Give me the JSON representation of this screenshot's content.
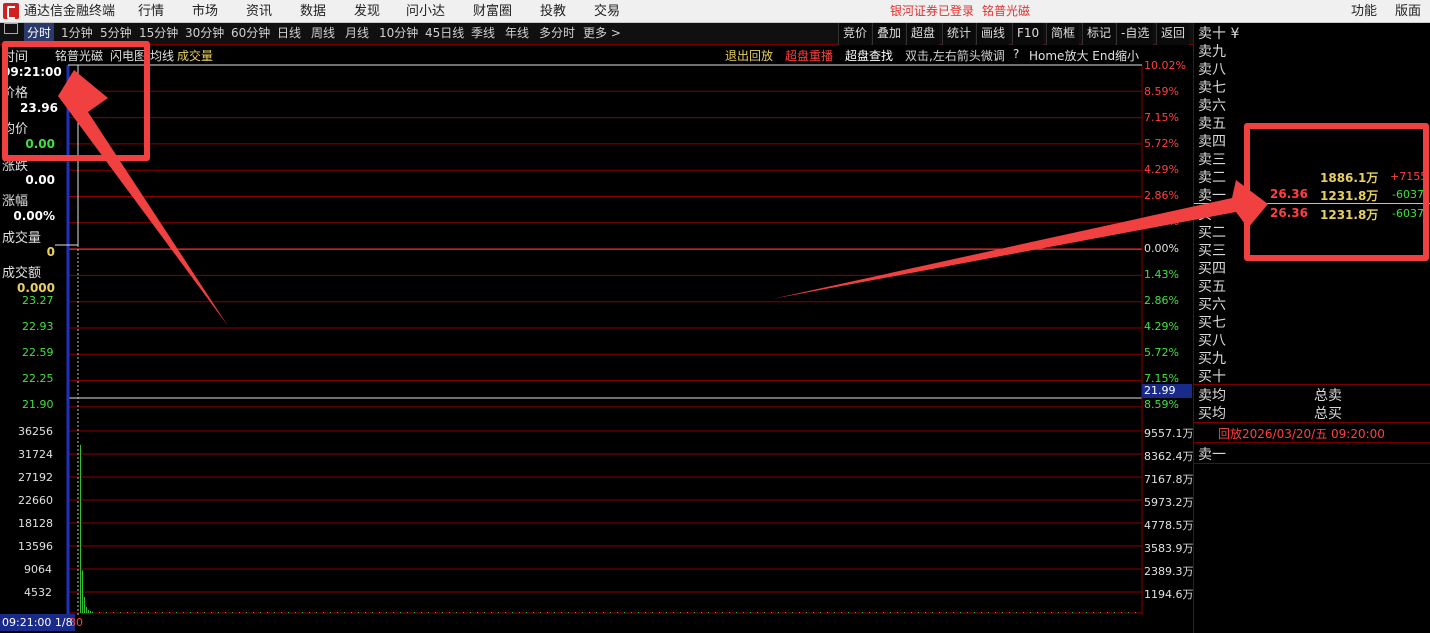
{
  "menubar": {
    "app_title": "通达信金融终端",
    "items": [
      "行情",
      "市场",
      "资讯",
      "数据",
      "发现",
      "问小达",
      "财富圈",
      "投教",
      "交易"
    ],
    "login_status": "银河证券已登录",
    "stock_name": "铭普光磁",
    "right_items": [
      "功能",
      "版面"
    ]
  },
  "tabs": {
    "items": [
      "分时",
      "1分钟",
      "5分钟",
      "15分钟",
      "30分钟",
      "60分钟",
      "日线",
      "周线",
      "月线",
      "10分钟",
      "45日线",
      "季线",
      "年线",
      "多分时",
      "更多 >"
    ],
    "active": "分时",
    "right_buttons": [
      "竞价",
      "叠加",
      "超盘",
      "统计",
      "画线",
      "F10",
      "简框",
      "标记",
      "-自选",
      "返回"
    ]
  },
  "chart_header": {
    "stock": "铭普光磁",
    "legend": [
      "闪电图",
      "均线",
      "成交量"
    ],
    "actions": [
      "退出回放",
      "超盘重播",
      "超盘查找",
      "双击,左右箭头微调",
      "?",
      "Home放大 End缩小"
    ]
  },
  "info_panel": {
    "time_label": "时间",
    "time_value": "09:21:00",
    "price_label": "价格",
    "price_value": "23.96",
    "avg_label": "均价",
    "avg_value": "0.00",
    "change_label": "涨跌",
    "change_value": "0.00",
    "pct_label": "涨幅",
    "pct_value": "0.00%",
    "volume_label": "成交量",
    "volume_value": "0",
    "amount_label": "成交额",
    "amount_value": "0.000"
  },
  "price_axis": {
    "left_labels": [
      "23.27",
      "22.93",
      "22.59",
      "22.25",
      "21.90"
    ],
    "right_labels": [
      "10.02%",
      "8.59%",
      "7.15%",
      "5.72%",
      "4.29%",
      "2.86%",
      "1.43%",
      "0.00%",
      "1.43%",
      "2.86%",
      "4.29%",
      "5.72%",
      "7.15%",
      "8.59%"
    ],
    "current_price_tag": "21.99"
  },
  "volume_axis": {
    "left_labels": [
      "36256",
      "31724",
      "27192",
      "22660",
      "18128",
      "13596",
      "9064",
      "4532"
    ],
    "right_labels": [
      "9557.1万",
      "8362.4万",
      "7167.8万",
      "5973.2万",
      "4778.5万",
      "3583.9万",
      "2389.3万",
      "1194.6万"
    ]
  },
  "bottom_status": {
    "time_cursor": "09:21:00 1/8",
    "tick": "30"
  },
  "chart_data": {
    "type": "line",
    "title": "",
    "series": [
      {
        "name": "成交量",
        "values": [
          33500,
          8500,
          3200,
          1200,
          600,
          400,
          300
        ]
      }
    ]
  },
  "orderbook": {
    "header": "卖十 ¥",
    "sell_labels": [
      "卖九",
      "卖八",
      "卖七",
      "卖六",
      "卖五",
      "卖四",
      "卖三",
      "卖二",
      "卖一"
    ],
    "buy_labels": [
      "买一",
      "买二",
      "买三",
      "买四",
      "买五",
      "买六",
      "买七",
      "买八",
      "买九",
      "买十"
    ],
    "sell2_volume": "1886.1万",
    "sell2_change": "+7155",
    "sell1_price": "26.36",
    "sell1_volume": "1231.8万",
    "sell1_change": "-6037",
    "buy1_price": "26.36",
    "buy1_volume": "1231.8万",
    "buy1_change": "-6037",
    "sell_avg": "卖均",
    "buy_avg": "买均",
    "total_sell": "总卖",
    "total_buy": "总买",
    "replay_date": "回放2026/03/20/五 09:20:00",
    "tick_label": "卖一"
  },
  "colors": {
    "grid": "#8b0000",
    "axis_red": "#ff4040",
    "axis_green": "#40e040",
    "highlight": "#f04040",
    "volume_bar": "#30c030"
  }
}
